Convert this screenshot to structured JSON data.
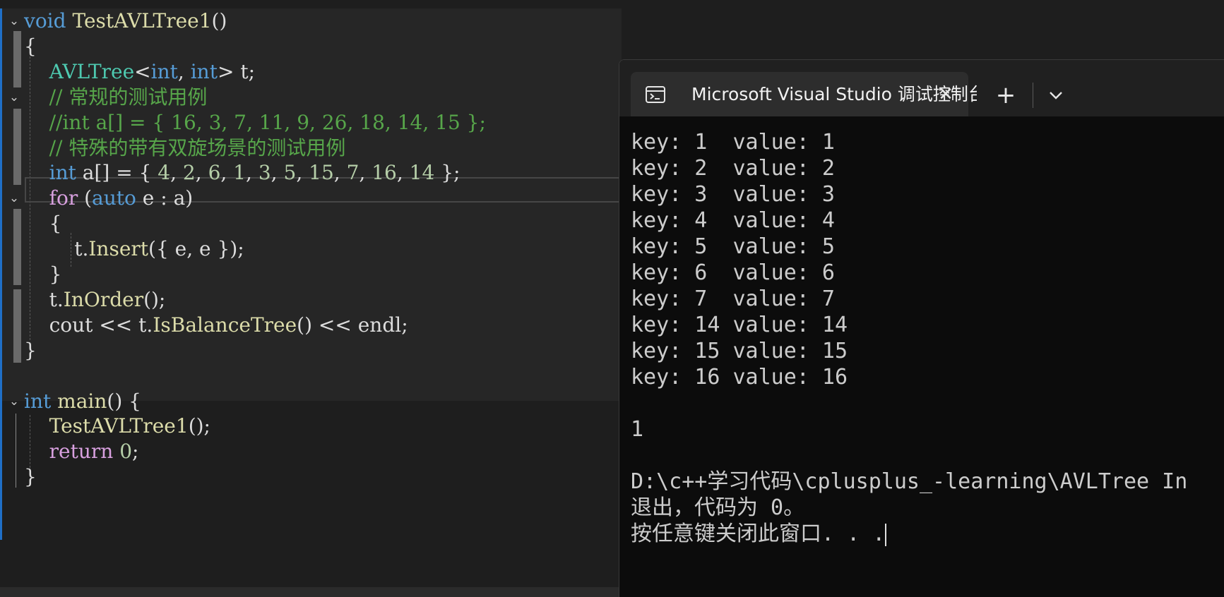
{
  "editor": {
    "lines": [
      {
        "fold": "⌄",
        "segs": [
          [
            "kw",
            "void"
          ],
          [
            "df",
            " "
          ],
          [
            "fn",
            "TestAVLTree1"
          ],
          [
            "df",
            "()"
          ]
        ]
      },
      {
        "fold": "",
        "segs": [
          [
            "df",
            "{"
          ]
        ]
      },
      {
        "fold": "",
        "segs": [
          [
            "df",
            "    "
          ],
          [
            "ty",
            "AVLTree"
          ],
          [
            "df",
            "<"
          ],
          [
            "kw",
            "int"
          ],
          [
            "df",
            ", "
          ],
          [
            "kw",
            "int"
          ],
          [
            "df",
            "> t;"
          ]
        ]
      },
      {
        "fold": "⌄",
        "segs": [
          [
            "df",
            "    "
          ],
          [
            "cm",
            "// 常规的测试用例"
          ]
        ]
      },
      {
        "fold": "",
        "segs": [
          [
            "df",
            "    "
          ],
          [
            "cm",
            "//int a[] = { 16, 3, 7, 11, 9, 26, 18, 14, 15 };"
          ]
        ]
      },
      {
        "fold": "",
        "segs": [
          [
            "df",
            "    "
          ],
          [
            "cm",
            "// 特殊的带有双旋场景的测试用例"
          ]
        ]
      },
      {
        "fold": "",
        "segs": [
          [
            "df",
            "    "
          ],
          [
            "kw",
            "int"
          ],
          [
            "df",
            " a[] = { "
          ],
          [
            "nm",
            "4"
          ],
          [
            "df",
            ", "
          ],
          [
            "nm",
            "2"
          ],
          [
            "df",
            ", "
          ],
          [
            "nm",
            "6"
          ],
          [
            "df",
            ", "
          ],
          [
            "nm",
            "1"
          ],
          [
            "df",
            ", "
          ],
          [
            "nm",
            "3"
          ],
          [
            "df",
            ", "
          ],
          [
            "nm",
            "5"
          ],
          [
            "df",
            ", "
          ],
          [
            "nm",
            "15"
          ],
          [
            "df",
            ", "
          ],
          [
            "nm",
            "7"
          ],
          [
            "df",
            ", "
          ],
          [
            "nm",
            "16"
          ],
          [
            "df",
            ", "
          ],
          [
            "nm",
            "14"
          ],
          [
            "df",
            " };"
          ]
        ]
      },
      {
        "fold": "⌄",
        "segs": [
          [
            "df",
            "    "
          ],
          [
            "ct",
            "for"
          ],
          [
            "df",
            " ("
          ],
          [
            "kw",
            "auto"
          ],
          [
            "df",
            " e : a)"
          ]
        ]
      },
      {
        "fold": "",
        "segs": [
          [
            "df",
            "    {"
          ]
        ]
      },
      {
        "fold": "",
        "segs": [
          [
            "df",
            "        t."
          ],
          [
            "fn",
            "Insert"
          ],
          [
            "df",
            "({ e, e });"
          ]
        ]
      },
      {
        "fold": "",
        "segs": [
          [
            "df",
            "    }"
          ]
        ]
      },
      {
        "fold": "",
        "segs": [
          [
            "df",
            "    t."
          ],
          [
            "fn",
            "InOrder"
          ],
          [
            "df",
            "();"
          ]
        ]
      },
      {
        "fold": "",
        "segs": [
          [
            "df",
            "    cout << t."
          ],
          [
            "fn",
            "IsBalanceTree"
          ],
          [
            "df",
            "() << endl;"
          ]
        ]
      },
      {
        "fold": "",
        "segs": [
          [
            "df",
            "}"
          ]
        ]
      },
      {
        "fold": "",
        "segs": []
      },
      {
        "fold": "⌄",
        "segs": [
          [
            "kw",
            "int"
          ],
          [
            "df",
            " "
          ],
          [
            "fn",
            "main"
          ],
          [
            "df",
            "() {"
          ]
        ]
      },
      {
        "fold": "",
        "segs": [
          [
            "df",
            "    "
          ],
          [
            "fn",
            "TestAVLTree1"
          ],
          [
            "df",
            "();"
          ]
        ]
      },
      {
        "fold": "",
        "segs": [
          [
            "df",
            "    "
          ],
          [
            "ct",
            "return"
          ],
          [
            "df",
            " "
          ],
          [
            "nm",
            "0"
          ],
          [
            "df",
            ";"
          ]
        ]
      },
      {
        "fold": "",
        "segs": [
          [
            "df",
            "}"
          ]
        ]
      }
    ]
  },
  "terminal": {
    "tab_title": "Microsoft Visual Studio 调试控制台",
    "tab_close": "✕",
    "new_tab": "+",
    "lines": [
      "key: 1  value: 1",
      "key: 2  value: 2",
      "key: 3  value: 3",
      "key: 4  value: 4",
      "key: 5  value: 5",
      "key: 6  value: 6",
      "key: 7  value: 7",
      "key: 14 value: 14",
      "key: 15 value: 15",
      "key: 16 value: 16",
      "",
      "1",
      "",
      "D:\\c++学习代码\\cplusplus_-learning\\AVLTree In",
      "退出，代码为 0。",
      "按任意键关闭此窗口. . ."
    ]
  },
  "colors": {
    "keyword": "#569cd6",
    "control": "#d8a0df",
    "comment": "#57a64a",
    "type": "#4ec9b0",
    "function": "#dcdcaa",
    "number": "#b5cea8",
    "text": "#dcdcdc"
  }
}
